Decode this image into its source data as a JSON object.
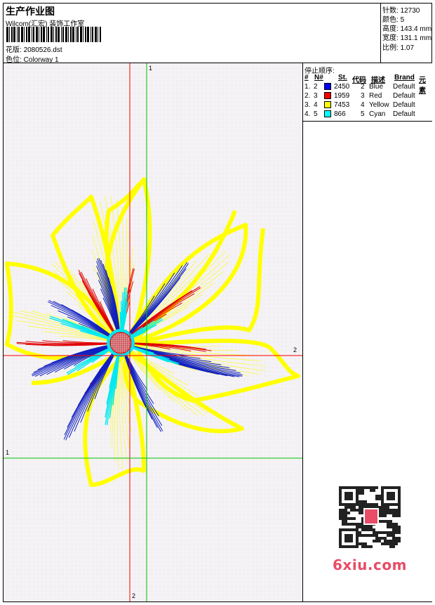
{
  "header": {
    "title": "生产作业图",
    "company": "Wilcom(汇宏) 装饰工作室",
    "design_label": "花版:",
    "design_value": "2080526.dst",
    "colorway_label": "色位:",
    "colorway_value": "Colorway 1"
  },
  "stats": [
    {
      "label": "针数:",
      "value": "12730"
    },
    {
      "label": "颜色:",
      "value": "5"
    },
    {
      "label": "高度:",
      "value": "143.4 mm"
    },
    {
      "label": "宽度:",
      "value": "131.1 mm"
    },
    {
      "label": "比例:",
      "value": "1.07"
    }
  ],
  "stop_sequence": {
    "title": "停止顺序:",
    "columns": [
      "#",
      "N#",
      "St.",
      "代码",
      "描述",
      "Brand",
      "元素"
    ],
    "rows": [
      {
        "idx": "1.",
        "n": "2",
        "color": "#0000ff",
        "st": "2450",
        "code": "2",
        "desc": "Blue",
        "brand": "Default"
      },
      {
        "idx": "2.",
        "n": "3",
        "color": "#ff0000",
        "st": "1959",
        "code": "3",
        "desc": "Red",
        "brand": "Default"
      },
      {
        "idx": "3.",
        "n": "4",
        "color": "#ffff00",
        "st": "7453",
        "code": "4",
        "desc": "Yellow",
        "brand": "Default"
      },
      {
        "idx": "4.",
        "n": "5",
        "color": "#00ffff",
        "st": "866",
        "code": "5",
        "desc": "Cyan",
        "brand": "Default"
      }
    ]
  },
  "axes": {
    "vertical_green_top": "1",
    "vertical_red_bottom": "2",
    "horizontal_red_right": "2",
    "horizontal_green_left": "1"
  },
  "watermark": "6xiu.com",
  "colors": {
    "blue": "#0000ff",
    "red": "#ff0000",
    "yellow": "#ffff00",
    "cyan": "#00ffff",
    "green_axis": "#00c000",
    "red_axis": "#ff0000"
  }
}
